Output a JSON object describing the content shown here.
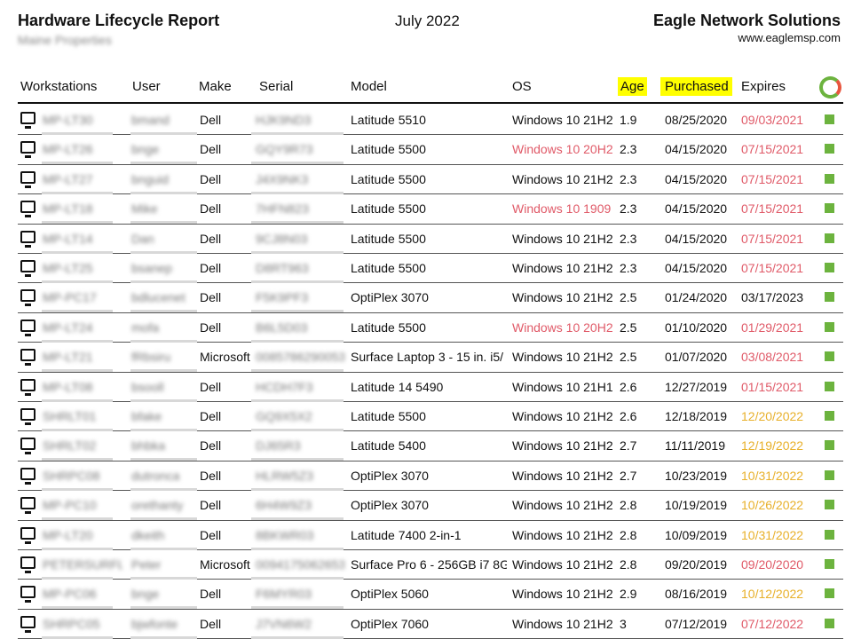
{
  "header": {
    "title": "Hardware Lifecycle Report",
    "subtitle": "Maine Properties",
    "date": "July 2022",
    "company": "Eagle Network Solutions",
    "website": "www.eaglemsp.com"
  },
  "columns": {
    "workstations": "Workstations",
    "user": "User",
    "make": "Make",
    "serial": "Serial",
    "model": "Model",
    "os": "OS",
    "age": "Age",
    "purchased": "Purchased",
    "expires": "Expires"
  },
  "colors": {
    "highlight": "#ffff00",
    "status_ok": "#6cb33e",
    "expired": "#e05a68",
    "expiring": "#e8b02a"
  },
  "rows": [
    {
      "ws": "MP-LT30",
      "user": "bmand",
      "make": "Dell",
      "serial": "HJK9ND3",
      "model": "Latitude 5510",
      "os": "Windows 10 21H2",
      "age": "1.9",
      "purchased": "08/25/2020",
      "expires": "09/03/2021",
      "os_status": "ok",
      "exp_status": "expired"
    },
    {
      "ws": "MP-LT26",
      "user": "bnge",
      "make": "Dell",
      "serial": "GQY9R73",
      "model": "Latitude 5500",
      "os": "Windows 10 20H2",
      "age": "2.3",
      "purchased": "04/15/2020",
      "expires": "07/15/2021",
      "os_status": "old",
      "exp_status": "expired"
    },
    {
      "ws": "MP-LT27",
      "user": "bnguid",
      "make": "Dell",
      "serial": "J4X9NK3",
      "model": "Latitude 5500",
      "os": "Windows 10 21H2",
      "age": "2.3",
      "purchased": "04/15/2020",
      "expires": "07/15/2021",
      "os_status": "ok",
      "exp_status": "expired"
    },
    {
      "ws": "MP-LT18",
      "user": "Mike",
      "make": "Dell",
      "serial": "7HFN823",
      "model": "Latitude 5500",
      "os": "Windows 10 1909",
      "age": "2.3",
      "purchased": "04/15/2020",
      "expires": "07/15/2021",
      "os_status": "old",
      "exp_status": "expired"
    },
    {
      "ws": "MP-LT14",
      "user": "Dan",
      "make": "Dell",
      "serial": "9CJ8N03",
      "model": "Latitude 5500",
      "os": "Windows 10 21H2",
      "age": "2.3",
      "purchased": "04/15/2020",
      "expires": "07/15/2021",
      "os_status": "ok",
      "exp_status": "expired"
    },
    {
      "ws": "MP-LT25",
      "user": "bsanep",
      "make": "Dell",
      "serial": "D8RT963",
      "model": "Latitude 5500",
      "os": "Windows 10 21H2",
      "age": "2.3",
      "purchased": "04/15/2020",
      "expires": "07/15/2021",
      "os_status": "ok",
      "exp_status": "expired"
    },
    {
      "ws": "MP-PC17",
      "user": "bdlucenet",
      "make": "Dell",
      "serial": "F5K9PF3",
      "model": "OptiPlex 3070",
      "os": "Windows 10 21H2",
      "age": "2.5",
      "purchased": "01/24/2020",
      "expires": "03/17/2023",
      "os_status": "ok",
      "exp_status": "ok"
    },
    {
      "ws": "MP-LT24",
      "user": "mofa",
      "make": "Dell",
      "serial": "B6L5D03",
      "model": "Latitude 5500",
      "os": "Windows 10 20H2",
      "age": "2.5",
      "purchased": "01/10/2020",
      "expires": "01/29/2021",
      "os_status": "old",
      "exp_status": "expired"
    },
    {
      "ws": "MP-LT21",
      "user": "fRbsiru",
      "make": "Microsoft",
      "serial": "0085786290053",
      "model": "Surface Laptop 3 - 15 in. i5/",
      "os": "Windows 10 21H2",
      "age": "2.5",
      "purchased": "01/07/2020",
      "expires": "03/08/2021",
      "os_status": "ok",
      "exp_status": "expired"
    },
    {
      "ws": "MP-LT08",
      "user": "bsooll",
      "make": "Dell",
      "serial": "HCDH7F3",
      "model": "Latitude 14 5490",
      "os": "Windows 10 21H1",
      "age": "2.6",
      "purchased": "12/27/2019",
      "expires": "01/15/2021",
      "os_status": "ok",
      "exp_status": "expired"
    },
    {
      "ws": "SHRLT01",
      "user": "bfake",
      "make": "Dell",
      "serial": "GQ9X5X2",
      "model": "Latitude 5500",
      "os": "Windows 10 21H2",
      "age": "2.6",
      "purchased": "12/18/2019",
      "expires": "12/20/2022",
      "os_status": "ok",
      "exp_status": "expiring"
    },
    {
      "ws": "SHRLT02",
      "user": "bhbka",
      "make": "Dell",
      "serial": "DJ65R3",
      "model": "Latitude 5400",
      "os": "Windows 10 21H2",
      "age": "2.7",
      "purchased": "11/11/2019",
      "expires": "12/19/2022",
      "os_status": "ok",
      "exp_status": "expiring"
    },
    {
      "ws": "SHRPC08",
      "user": "dutronca",
      "make": "Dell",
      "serial": "HLRW5Z3",
      "model": "OptiPlex 3070",
      "os": "Windows 10 21H2",
      "age": "2.7",
      "purchased": "10/23/2019",
      "expires": "10/31/2022",
      "os_status": "ok",
      "exp_status": "expiring"
    },
    {
      "ws": "MP-PC10",
      "user": "orethanty",
      "make": "Dell",
      "serial": "6H4W9Z3",
      "model": "OptiPlex 3070",
      "os": "Windows 10 21H2",
      "age": "2.8",
      "purchased": "10/19/2019",
      "expires": "10/26/2022",
      "os_status": "ok",
      "exp_status": "expiring"
    },
    {
      "ws": "MP-LT20",
      "user": "dkeith",
      "make": "Dell",
      "serial": "8BKWR03",
      "model": "Latitude 7400 2-in-1",
      "os": "Windows 10 21H2",
      "age": "2.8",
      "purchased": "10/09/2019",
      "expires": "10/31/2022",
      "os_status": "ok",
      "exp_status": "expiring"
    },
    {
      "ws": "PETERSURFL",
      "user": "Peter",
      "make": "Microsoft",
      "serial": "0094175062653",
      "model": "Surface Pro 6 - 256GB i7 8G",
      "os": "Windows 10 21H2",
      "age": "2.8",
      "purchased": "09/20/2019",
      "expires": "09/20/2020",
      "os_status": "ok",
      "exp_status": "expired"
    },
    {
      "ws": "MP-PC06",
      "user": "bnge",
      "make": "Dell",
      "serial": "F6MYR03",
      "model": "OptiPlex 5060",
      "os": "Windows 10 21H2",
      "age": "2.9",
      "purchased": "08/16/2019",
      "expires": "10/12/2022",
      "os_status": "ok",
      "exp_status": "expiring"
    },
    {
      "ws": "SHRPC05",
      "user": "bjwfonte",
      "make": "Dell",
      "serial": "J7VN6W2",
      "model": "OptiPlex 7060",
      "os": "Windows 10 21H2",
      "age": "3",
      "purchased": "07/12/2019",
      "expires": "07/12/2022",
      "os_status": "ok",
      "exp_status": "expired"
    }
  ]
}
